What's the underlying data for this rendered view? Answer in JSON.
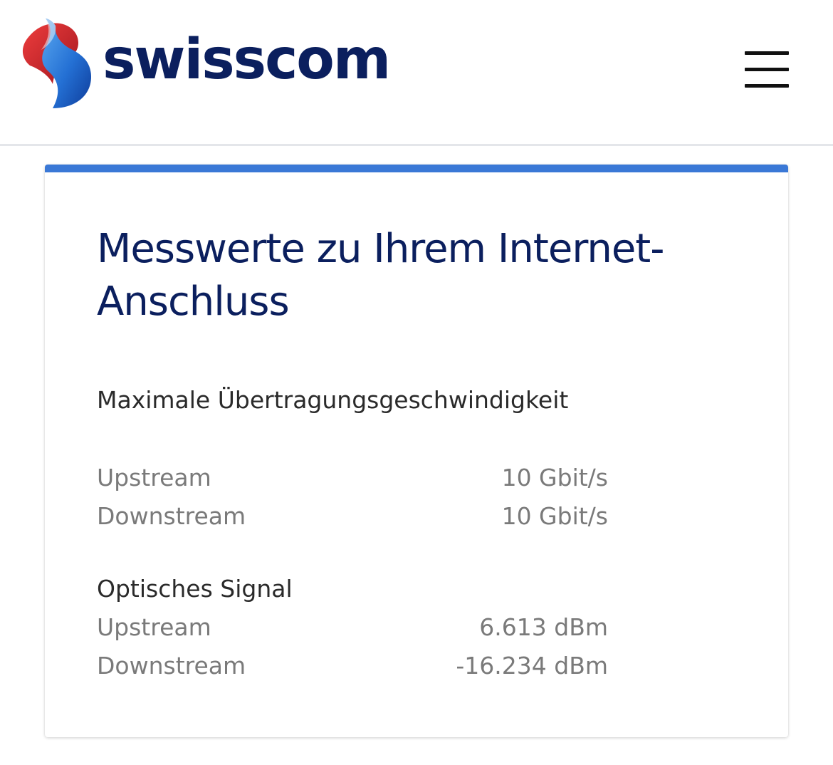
{
  "header": {
    "brand_name": "swisscom",
    "logo_icon": "swisscom-lifeform-logo-icon",
    "menu_icon": "hamburger-menu-icon"
  },
  "colors": {
    "brand_text": "#0b1f5e",
    "accent": "#3a78d6",
    "logo_red": "#d62b2b",
    "logo_blue": "#1e63c6"
  },
  "card": {
    "title": "Messwerte zu Ihrem Internet-Anschluss",
    "sections": [
      {
        "title": "Maximale Übertragungsgeschwindigkeit",
        "rows": [
          {
            "label": "Upstream",
            "value": "10 Gbit/s"
          },
          {
            "label": "Downstream",
            "value": "10 Gbit/s"
          }
        ]
      },
      {
        "title": "Optisches Signal",
        "rows": [
          {
            "label": "Upstream",
            "value": "6.613 dBm"
          },
          {
            "label": "Downstream",
            "value": "-16.234 dBm"
          }
        ]
      }
    ]
  }
}
